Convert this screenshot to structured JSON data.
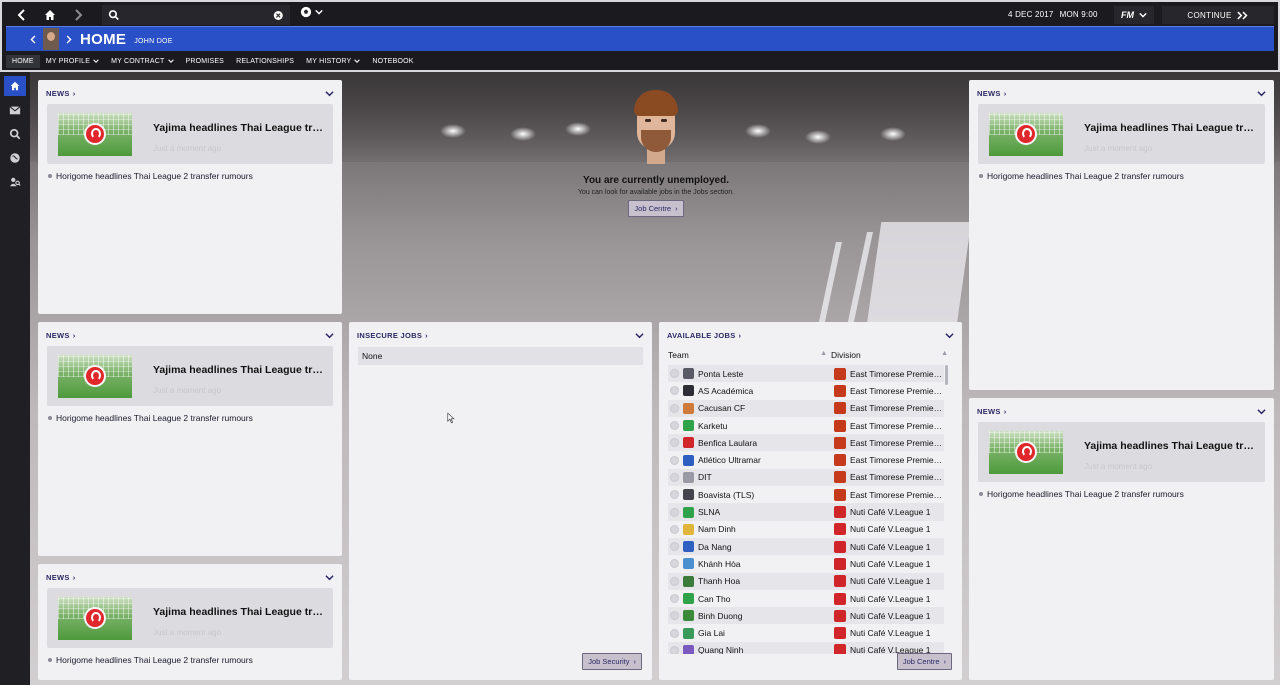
{
  "topbar": {
    "date": "4 DEC 2017",
    "time": "MON 9:00",
    "fm_label": "FM",
    "continue_label": "CONTINUE",
    "search": {
      "value": "",
      "placeholder": ""
    }
  },
  "titlebar": {
    "title": "HOME",
    "subtitle": "JOHN DOE"
  },
  "nav": {
    "items": [
      {
        "label": "HOME"
      },
      {
        "label": "MY PROFILE"
      },
      {
        "label": "MY CONTRACT"
      },
      {
        "label": "PROMISES"
      },
      {
        "label": "RELATIONSHIPS"
      },
      {
        "label": "MY HISTORY"
      },
      {
        "label": "NOTEBOOK"
      }
    ]
  },
  "news": {
    "title": "NEWS",
    "headline": "Yajima headlines Thai League transfer rumours",
    "time": "Just a moment ago",
    "bullet": "Horigome headlines Thai League 2 transfer rumours"
  },
  "unemployed": {
    "title": "You are currently unemployed.",
    "subtitle": "You can look for available jobs in the Jobs section.",
    "button": "Job Centre"
  },
  "insecure_jobs": {
    "title": "INSECURE JOBS",
    "none_label": "None",
    "button": "Job Security"
  },
  "available_jobs": {
    "title": "AVAILABLE JOBS",
    "col_team": "Team",
    "col_division": "Division",
    "button": "Job Centre",
    "rows": [
      {
        "team": "Ponta Leste",
        "division": "East Timorese Premier League",
        "crest": "#5a5a66",
        "league": "#c43a1a"
      },
      {
        "team": "AS Académica",
        "division": "East Timorese Premier League",
        "crest": "#2d2d35",
        "league": "#c43a1a"
      },
      {
        "team": "Cacusan CF",
        "division": "East Timorese Premier League",
        "crest": "#d07a3a",
        "league": "#c43a1a"
      },
      {
        "team": "Karketu",
        "division": "East Timorese Premier League",
        "crest": "#2fa24a",
        "league": "#c43a1a"
      },
      {
        "team": "Benfica Laulara",
        "division": "East Timorese Premier League",
        "crest": "#d0262a",
        "league": "#c43a1a"
      },
      {
        "team": "Atlético Ultramar",
        "division": "East Timorese Premier League",
        "crest": "#2f5fc0",
        "league": "#c43a1a"
      },
      {
        "team": "DIT",
        "division": "East Timorese Premier League",
        "crest": "#9a9aa4",
        "league": "#c43a1a"
      },
      {
        "team": "Boavista (TLS)",
        "division": "East Timorese Premier League",
        "crest": "#44444c",
        "league": "#c43a1a"
      },
      {
        "team": "SLNA",
        "division": "Nuti Café V.League 1",
        "crest": "#2fa24a",
        "league": "#d0262a"
      },
      {
        "team": "Nam Dinh",
        "division": "Nuti Café V.League 1",
        "crest": "#e0b53a",
        "league": "#d0262a"
      },
      {
        "team": "Da Nang",
        "division": "Nuti Café V.League 1",
        "crest": "#2f5fc0",
        "league": "#d0262a"
      },
      {
        "team": "Khánh Hòa",
        "division": "Nuti Café V.League 1",
        "crest": "#4a8fd0",
        "league": "#d0262a"
      },
      {
        "team": "Thanh Hoa",
        "division": "Nuti Café V.League 1",
        "crest": "#3a7a3a",
        "league": "#d0262a"
      },
      {
        "team": "Can Tho",
        "division": "Nuti Café V.League 1",
        "crest": "#2fa24a",
        "league": "#d0262a"
      },
      {
        "team": "Binh Duong",
        "division": "Nuti Café V.League 1",
        "crest": "#3a8a3a",
        "league": "#d0262a"
      },
      {
        "team": "Gia Lai",
        "division": "Nuti Café V.League 1",
        "crest": "#3a9a5a",
        "league": "#d0262a"
      },
      {
        "team": "Quang Ninh",
        "division": "Nuti Café V.League 1",
        "crest": "#7a5ac0",
        "league": "#d0262a"
      }
    ]
  },
  "colors": {
    "accent": "#2a50c8",
    "panel": "#f1f1f4",
    "header_text": "#2c2866"
  }
}
